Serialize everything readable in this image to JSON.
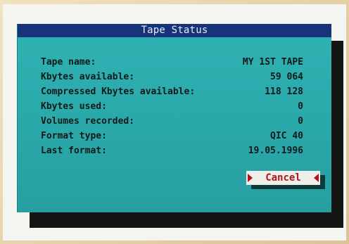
{
  "dialog": {
    "title": "Tape Status",
    "fields": [
      {
        "label": "Tape name:",
        "value": "MY 1ST TAPE"
      },
      {
        "label": "Kbytes available:",
        "value": "59 064"
      },
      {
        "label": "Compressed Kbytes available:",
        "value": "118 128"
      },
      {
        "label": "Kbytes used:",
        "value": "0"
      },
      {
        "label": "Volumes recorded:",
        "value": "0"
      },
      {
        "label": "Format type:",
        "value": "QIC 40"
      },
      {
        "label": "Last format:",
        "value": "19.05.1996"
      }
    ],
    "cancel_label": "Cancel"
  },
  "colors": {
    "dialog_bg": "#2aa8aa",
    "titlebar_bg": "#17347a",
    "titlebar_text": "#e7edf6",
    "button_text": "#b3141c",
    "button_bg": "#efefea"
  },
  "icons": {
    "left_pointer": "left-triangle-icon",
    "right_pointer": "right-triangle-icon"
  }
}
